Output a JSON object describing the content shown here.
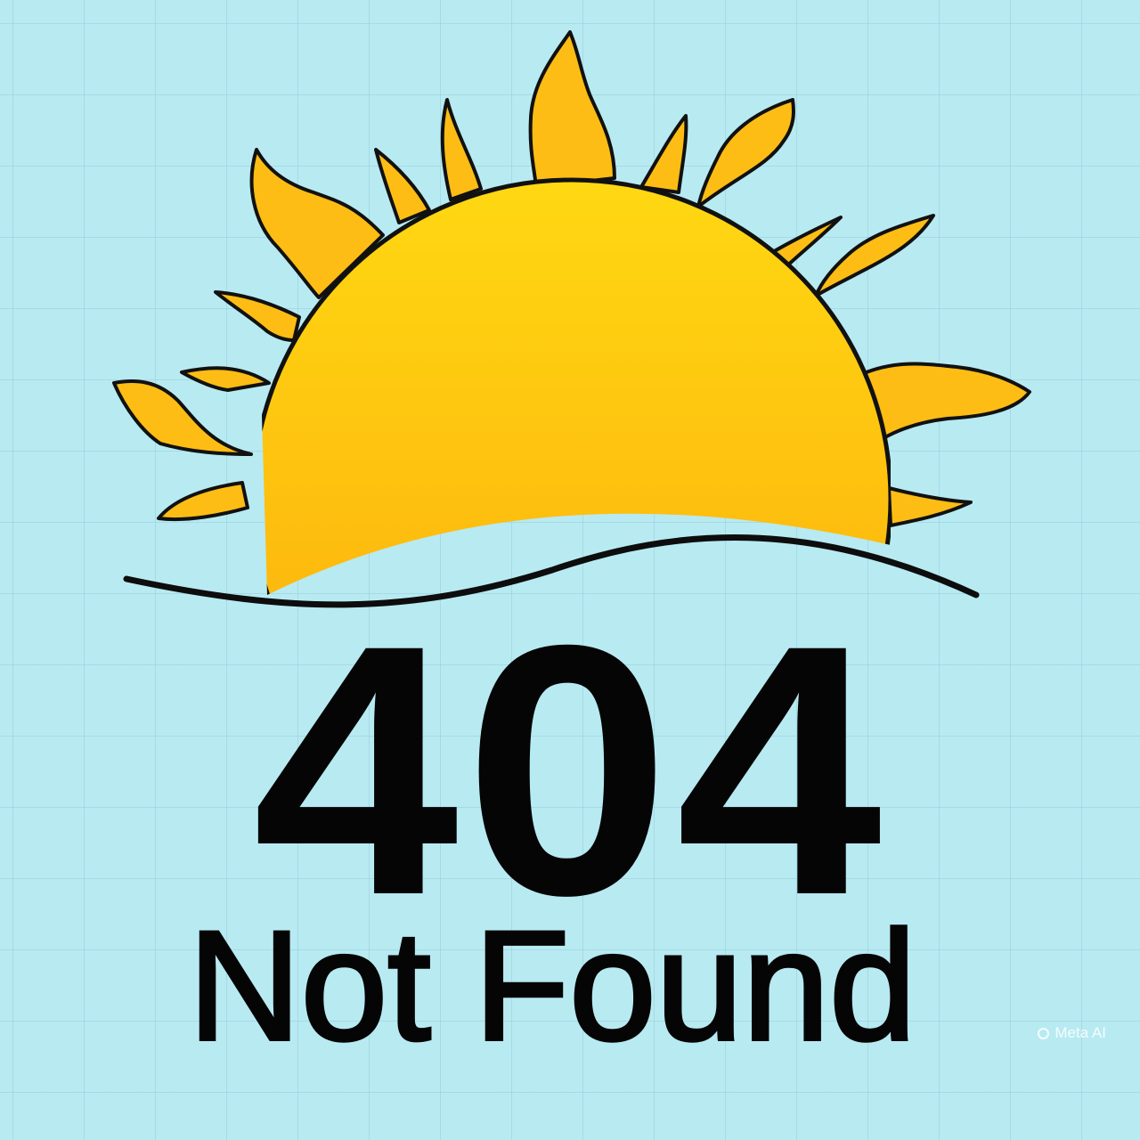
{
  "error": {
    "code": "404",
    "message": "Not Found"
  },
  "watermark": {
    "label": "Meta AI"
  },
  "illustration": {
    "subject": "sun-icon",
    "sun_top_color": "#ffd812",
    "sun_bottom_color": "#fca90c",
    "ray_color": "#fdbd14",
    "outline_color": "#111111",
    "background_color": "#b8eaf2",
    "grid_color": "#96cddc"
  }
}
